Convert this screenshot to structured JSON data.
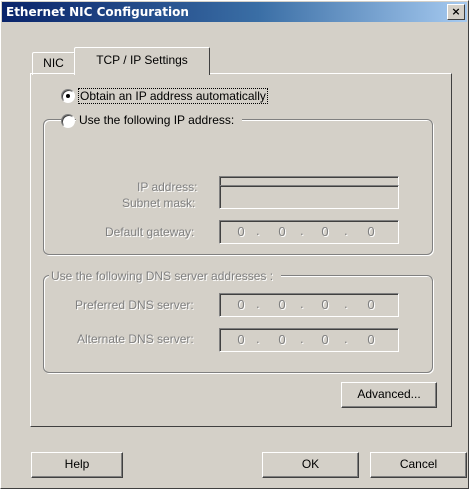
{
  "window": {
    "title": "Ethernet NIC Configuration",
    "close_glyph": "×"
  },
  "tabs": [
    {
      "label": "NIC",
      "selected": false
    },
    {
      "label": "TCP / IP Settings",
      "selected": true
    }
  ],
  "ip": {
    "auto_label": "Obtain an IP address automatically",
    "auto_selected": true,
    "manual_label": "Use the following IP address:",
    "manual_selected": false,
    "fields": [
      {
        "label": "IP address:",
        "segments": [
          "",
          "",
          "",
          ""
        ]
      },
      {
        "label": "Subnet mask:",
        "segments": [
          "",
          "",
          "",
          ""
        ]
      },
      {
        "label": "Default gateway:",
        "segments": [
          "0",
          "0",
          "0",
          "0"
        ]
      }
    ]
  },
  "dns": {
    "group_label": "Use the following DNS server addresses :",
    "fields": [
      {
        "label": "Preferred DNS server:",
        "segments": [
          "0",
          "0",
          "0",
          "0"
        ]
      },
      {
        "label": "Alternate DNS server:",
        "segments": [
          "0",
          "0",
          "0",
          "0"
        ]
      }
    ]
  },
  "buttons": {
    "advanced": "Advanced...",
    "help": "Help",
    "ok": "OK",
    "cancel": "Cancel"
  },
  "dot": "."
}
